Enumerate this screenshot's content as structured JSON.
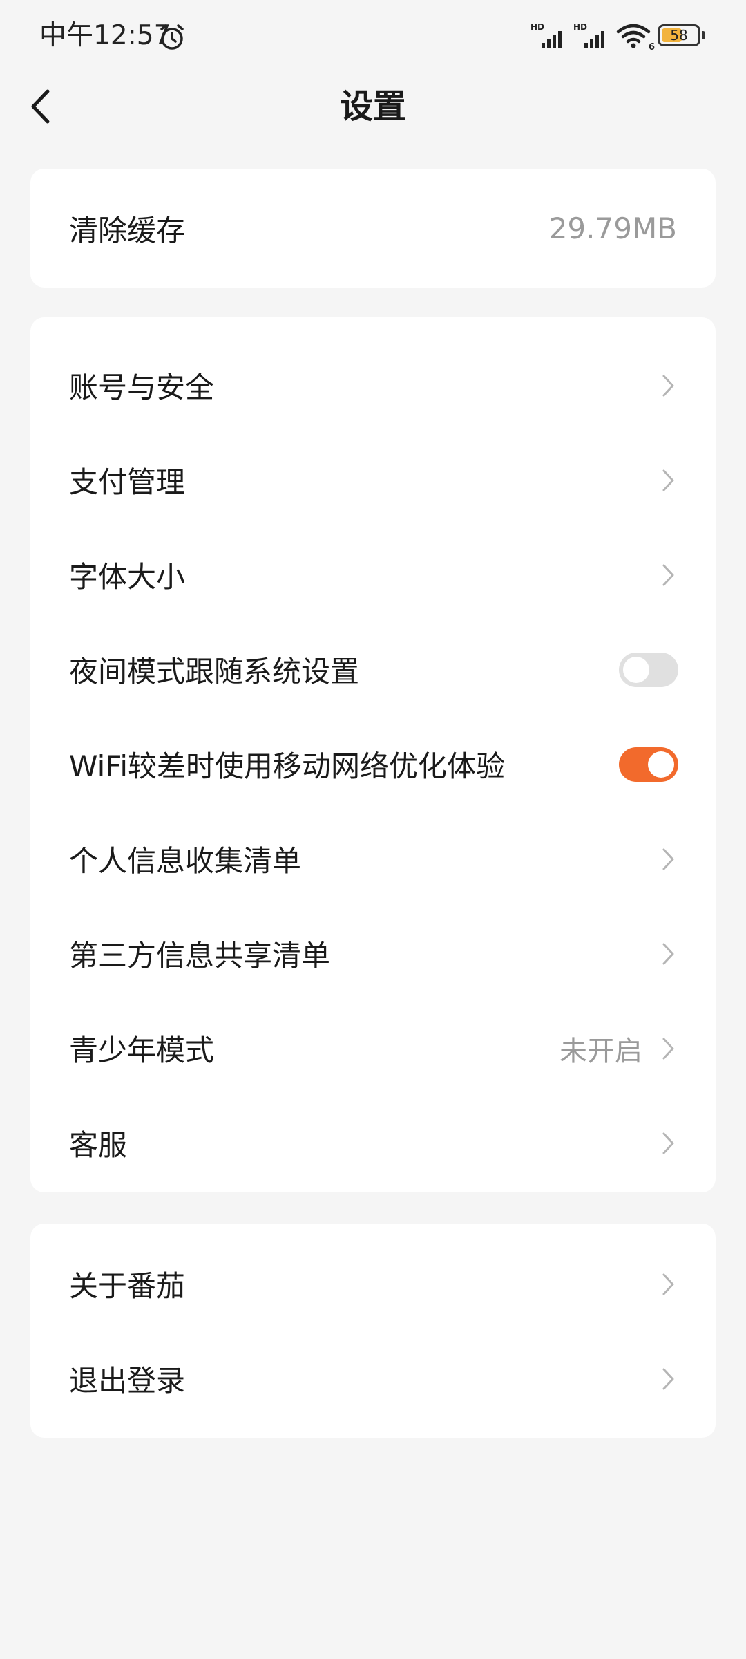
{
  "status_bar": {
    "time": "中午12:57",
    "hd_label_1": "HD",
    "hd_label_2": "HD",
    "wifi_badge": "6",
    "battery_percent": "58",
    "battery_level": 0.58,
    "icons": [
      "alarm-icon",
      "signal-icon",
      "signal-icon",
      "wifi-icon",
      "battery-icon"
    ]
  },
  "header": {
    "title": "设置",
    "back_icon": "chevron-left-icon"
  },
  "cache": {
    "label": "清除缓存",
    "value": "29.79MB"
  },
  "settings": {
    "account_security": "账号与安全",
    "payment": "支付管理",
    "font_size": "字体大小",
    "night_mode": {
      "label": "夜间模式跟随系统设置",
      "enabled": false
    },
    "wifi_optimize": {
      "label": "WiFi较差时使用移动网络优化体验",
      "enabled": true
    },
    "personal_info": "个人信息收集清单",
    "third_party": "第三方信息共享清单",
    "teen_mode": {
      "label": "青少年模式",
      "value": "未开启"
    },
    "customer_service": "客服"
  },
  "about": {
    "about_label": "关于番茄",
    "logout_label": "退出登录"
  },
  "colors": {
    "accent": "#f26a2c",
    "background": "#f5f5f5",
    "card": "#ffffff",
    "secondary_text": "#9a9a9a",
    "battery": "#f2b33d"
  }
}
